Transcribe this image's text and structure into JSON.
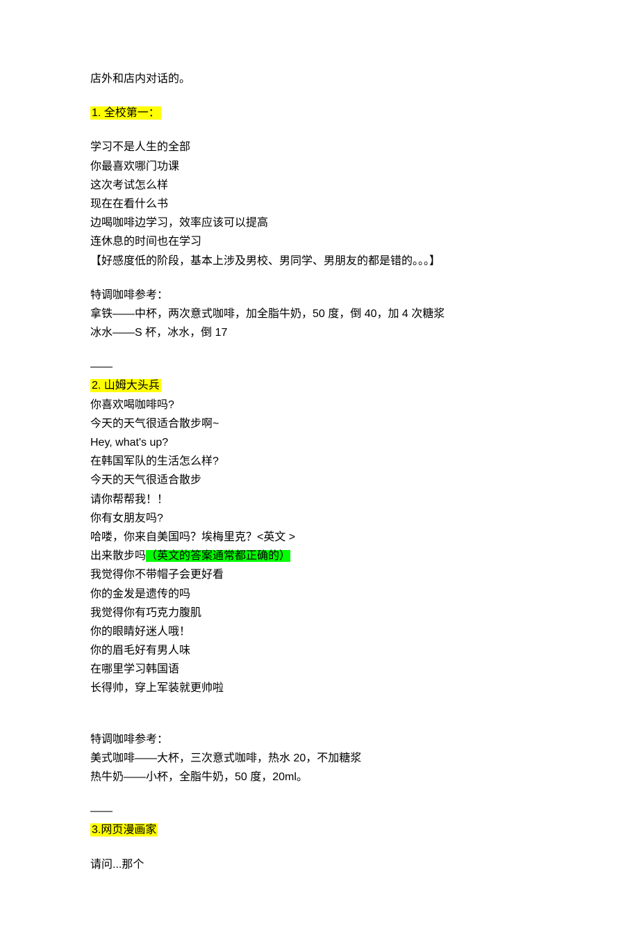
{
  "intro": "店外和店内对话的。",
  "sections": [
    {
      "heading": "1. 全校第一：",
      "heading_trailing_space": " ",
      "dialogue": [
        "学习不是人生的全部",
        "你最喜欢哪门功课",
        "这次考试怎么样",
        "现在在看什么书",
        "边喝咖啡边学习，效率应该可以提高",
        "连休息的时间也在学习",
        "【好感度低的阶段，基本上涉及男校、男同学、男朋友的都是错的。。。】"
      ],
      "coffee_header": "特调咖啡参考：",
      "coffee": [
        "拿铁——中杯，两次意式咖啡，加全脂牛奶，50 度，倒 40，加 4 次糖浆",
        "冰水——S 杯，冰水，倒 17"
      ],
      "divider": "——"
    },
    {
      "heading": "2. 山姆大头兵",
      "dialogue_pre": [
        "你喜欢喝咖啡吗?",
        "今天的天气很适合散步啊~",
        "Hey, what's up?",
        "在韩国军队的生活怎么样?",
        "今天的天气很适合散步",
        "请你帮帮我！！",
        "你有女朋友吗?",
        "哈喽，你来自美国吗？埃梅里克？<英文 >"
      ],
      "mixed_line_prefix": "出来散步吗",
      "mixed_line_green": "（英文的答案通常都正确的）",
      "dialogue_post": [
        "我觉得你不带帽子会更好看",
        "你的金发是遗传的吗",
        "我觉得你有巧克力腹肌",
        "你的眼睛好迷人哦！",
        "你的眉毛好有男人味",
        "在哪里学习韩国语",
        "长得帅，穿上军装就更帅啦"
      ],
      "coffee_header": "特调咖啡参考：",
      "coffee": [
        "美式咖啡——大杯，三次意式咖啡，热水 20，不加糖浆",
        "热牛奶——小杯，全脂牛奶，50 度，20ml。"
      ],
      "divider": "——"
    },
    {
      "heading": "3.网页漫画家",
      "dialogue": [
        "请问...那个"
      ]
    }
  ]
}
